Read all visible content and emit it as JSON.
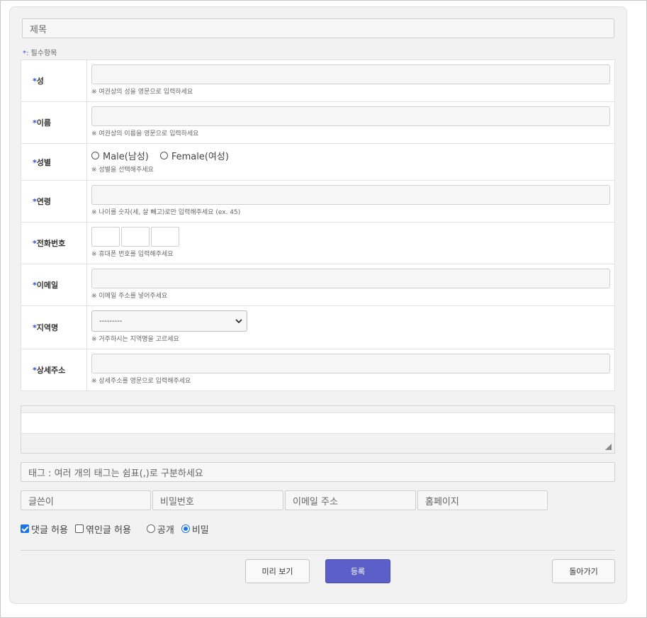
{
  "title_placeholder": "제목",
  "required_note": {
    "star": "*",
    "text": ": 필수항목"
  },
  "rows": [
    {
      "label": "성",
      "hint": "※ 여권상의 성을 영문으로 입력하세요"
    },
    {
      "label": "이름",
      "hint": "※ 여권상의 이름을 영문으로 입력하세요"
    },
    {
      "label": "성별",
      "hint": "※ 성별을 선택해주세요",
      "options": [
        "Male(남성)",
        "Female(여성)"
      ]
    },
    {
      "label": "연령",
      "hint": "※ 나이를 숫자(세, 살 빼고)로만 입력해주세요 (ex. 45)"
    },
    {
      "label": "전화번호",
      "hint": "※ 휴대폰 번호를 입력해주세요"
    },
    {
      "label": "이메일",
      "hint": "※ 이메일 주소를 넣어주세요"
    },
    {
      "label": "지역명",
      "hint": "※ 거주하시는 지역명을 고르세요",
      "select_value": "---------"
    },
    {
      "label": "상세주소",
      "hint": "※ 상세주소를 영문으로 입력해주세요"
    }
  ],
  "tags_placeholder": "태그 : 여러 개의 태그는 쉼표(,)로 구분하세요",
  "author_fields": {
    "writer": "글쓴이",
    "password": "비밀번호",
    "email": "이메일 주소",
    "homepage": "홈페이지"
  },
  "options": {
    "allow_comment": {
      "label": "댓글 허용",
      "checked": true
    },
    "allow_trackback": {
      "label": "엮인글 허용",
      "checked": false
    },
    "visibility": [
      {
        "label": "공개",
        "selected": false
      },
      {
        "label": "비밀",
        "selected": true
      }
    ]
  },
  "buttons": {
    "preview": "미리 보기",
    "submit": "등록",
    "back": "돌아가기"
  },
  "colors": {
    "accent": "#5b5fc7",
    "required_star": "#2a4fd4",
    "checkbox": "#1a73e8"
  }
}
